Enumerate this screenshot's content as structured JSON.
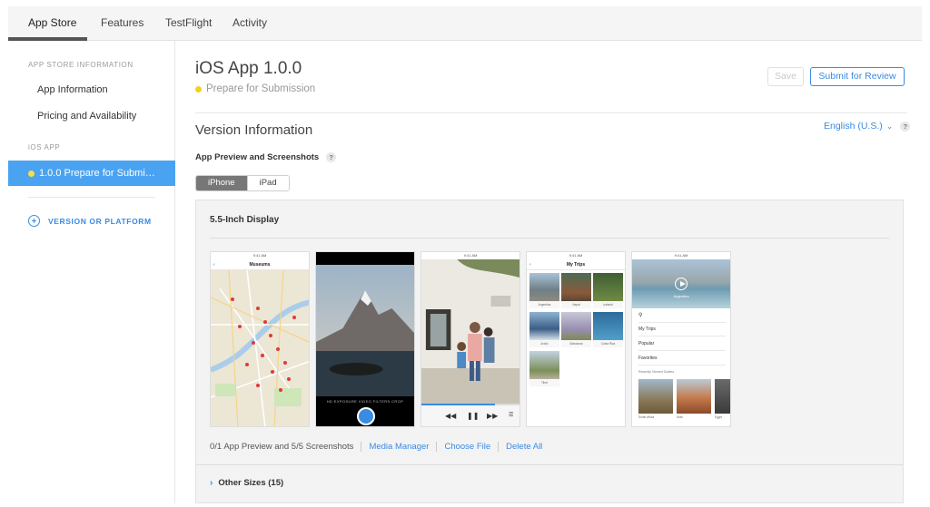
{
  "tabs": [
    {
      "label": "App Store",
      "active": true
    },
    {
      "label": "Features",
      "active": false
    },
    {
      "label": "TestFlight",
      "active": false
    },
    {
      "label": "Activity",
      "active": false
    }
  ],
  "sidebar": {
    "section1_heading": "APP STORE INFORMATION",
    "items": [
      "App Information",
      "Pricing and Availability"
    ],
    "section2_heading": "iOS APP",
    "selected_version": "1.0.0 Prepare for Submi…",
    "add_label": "VERSION OR PLATFORM"
  },
  "header": {
    "title": "iOS App 1.0.0",
    "status": "Prepare for Submission",
    "save_label": "Save",
    "submit_label": "Submit for Review"
  },
  "version_info": {
    "title": "Version Information",
    "language": "English (U.S.)",
    "help": "?",
    "preview_label": "App Preview and Screenshots",
    "devices": [
      "iPhone",
      "iPad"
    ],
    "selected_device": "iPhone"
  },
  "panel": {
    "display_title": "5.5-Inch Display",
    "screens": {
      "status_time": "9:41 AM",
      "museums_title": "Museums",
      "camera_modes": "HD  EXPOSURE  VIDEO  FILTERS  CROP",
      "trips_title": "My Trips",
      "trip_tiles": [
        "Argentina",
        "Nepal",
        "Iceland",
        "Arctic",
        "Botswana",
        "Costa Rica",
        "Tibet"
      ],
      "hero_caption": "Argentina",
      "menu_items": [
        "My Trips",
        "Popular",
        "Favorites"
      ],
      "recently_viewed": "Recently Viewed Guides",
      "guide_thumbs": [
        "South Africa",
        "Utah",
        "Egypt"
      ]
    },
    "count_text": "0/1 App Preview and 5/5 Screenshots",
    "links": [
      "Media Manager",
      "Choose File",
      "Delete All"
    ],
    "other_sizes": "Other Sizes (15)"
  }
}
